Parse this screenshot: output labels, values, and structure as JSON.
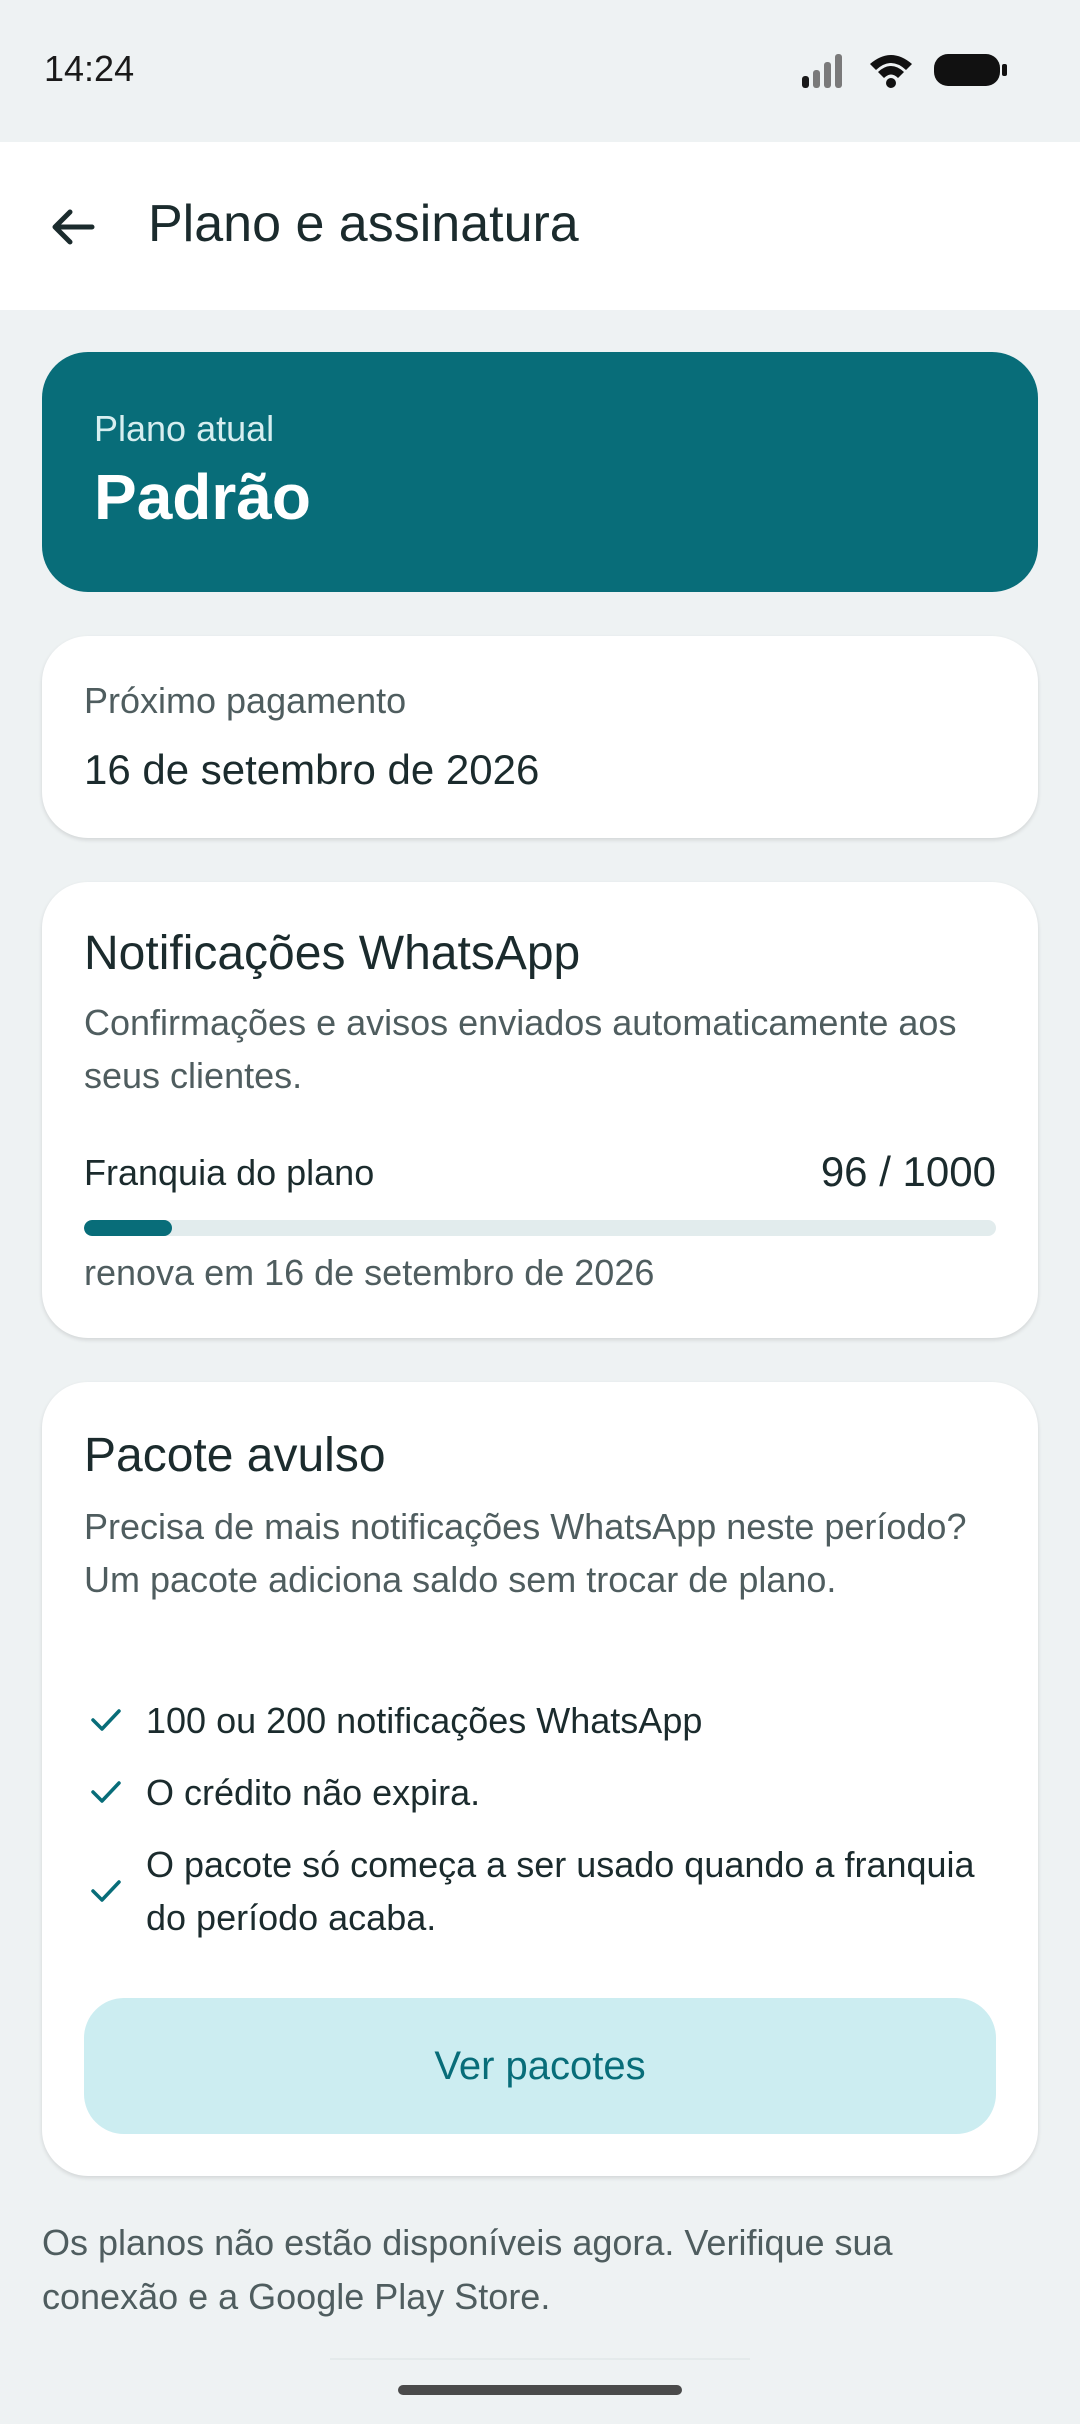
{
  "status_bar": {
    "time": "14:24",
    "icons": [
      "signal-icon",
      "wifi-icon",
      "battery-icon"
    ]
  },
  "app_bar": {
    "title": "Plano e assinatura",
    "back_icon": "arrow-back-icon"
  },
  "plan": {
    "label": "Plano atual",
    "name": "Padrão"
  },
  "next_payment": {
    "label": "Próximo pagamento",
    "date": "16 de setembro de 2026"
  },
  "whatsapp": {
    "title": "Notificações WhatsApp",
    "description": "Confirmações e avisos enviados automaticamente aos seus clientes.",
    "quota_label": "Franquia do plano",
    "quota_value": "96 / 1000",
    "used": 96,
    "total": 1000,
    "renewal": "renova em 16 de setembro de 2026"
  },
  "package": {
    "title": "Pacote avulso",
    "description": "Precisa de mais notificações WhatsApp neste período? Um pacote adiciona saldo sem trocar de plano.",
    "benefits": [
      "100 ou 200 notificações WhatsApp",
      "O crédito não expira.",
      "O pacote só começa a ser usado quando a franquia do período acaba."
    ],
    "button_label": "Ver pacotes"
  },
  "footer_note": "Os planos não estão disponíveis agora. Verifique sua conexão e a Google Play Store.",
  "colors": {
    "primary": "#086d79",
    "button_bg": "#ccedf1",
    "background": "#eef2f3"
  }
}
